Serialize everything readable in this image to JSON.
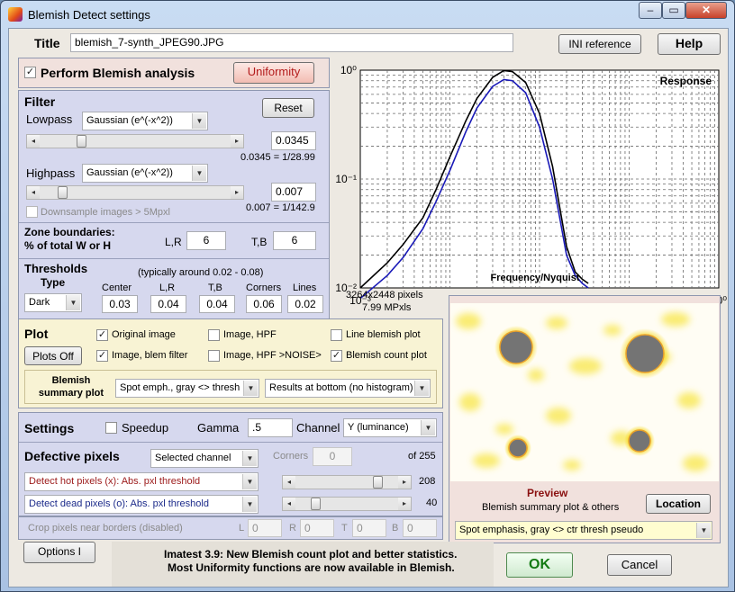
{
  "window": {
    "title": "Blemish Detect settings",
    "controls": {
      "minimize": "–",
      "maximize": "▭",
      "close": "✕"
    }
  },
  "title_row": {
    "label": "Title",
    "value": "blemish_7-synth_JPEG90.JPG",
    "ini_button": "INI reference",
    "help_button": "Help"
  },
  "blemish": {
    "perform_label": "Perform Blemish analysis",
    "perform_checked": true,
    "uniformity_button": "Uniformity"
  },
  "filter": {
    "heading": "Filter",
    "reset_button": "Reset",
    "lowpass": {
      "label": "Lowpass",
      "type": "Gaussian (e^(-x^2))",
      "value": "0.0345",
      "caption": "0.0345 = 1/28.99",
      "slider_fraction": 0.2
    },
    "highpass": {
      "label": "Highpass",
      "type": "Gaussian (e^(-x^2))",
      "value": "0.007",
      "caption": "0.007 = 1/142.9",
      "slider_fraction": 0.1
    },
    "downsample_label": "Downsample images > 5Mpxl",
    "downsample_checked": false
  },
  "zone": {
    "heading": "Zone boundaries:",
    "subheading": "% of total W or H",
    "lr_label": "L,R",
    "lr_value": "6",
    "tb_label": "T,B",
    "tb_value": "6"
  },
  "thresholds": {
    "heading": "Thresholds",
    "note": "(typically around 0.02 - 0.08)",
    "type_label": "Type",
    "type_value": "Dark",
    "columns": [
      {
        "label": "Center",
        "value": "0.03"
      },
      {
        "label": "L,R",
        "value": "0.04"
      },
      {
        "label": "T,B",
        "value": "0.04"
      },
      {
        "label": "Corners",
        "value": "0.06"
      },
      {
        "label": "Lines",
        "value": "0.02"
      }
    ]
  },
  "plot": {
    "heading": "Plot",
    "plots_off_button": "Plots Off",
    "options": [
      {
        "label": "Original image",
        "checked": true
      },
      {
        "label": "Image, HPF",
        "checked": false
      },
      {
        "label": "Line blemish plot",
        "checked": false
      },
      {
        "label": "Image, blem filter",
        "checked": true
      },
      {
        "label": "Image, HPF >NOISE>",
        "checked": false
      },
      {
        "label": "Blemish count plot",
        "checked": true
      }
    ],
    "summary_label": "Blemish summary plot",
    "summary_select": "Spot emph., gray <> thresh",
    "results_select": "Results at bottom (no histogram)"
  },
  "settings": {
    "heading": "Settings",
    "speedup_label": "Speedup",
    "speedup_checked": false,
    "gamma_label": "Gamma",
    "gamma_value": ".5",
    "channel_label": "Channel",
    "channel_value": "Y (luminance)"
  },
  "defective": {
    "heading": "Defective pixels",
    "channel_select": "Selected channel",
    "corners_label": "Corners",
    "corners_value": "0",
    "of_label": "of 255",
    "hot": {
      "label": "Detect hot pixels (x):",
      "mode": "Abs. pxl threshold",
      "value": "208",
      "fraction": 0.82
    },
    "dead": {
      "label": "Detect dead pixels (o):",
      "mode": "Abs. pxl threshold",
      "value": "40",
      "fraction": 0.16
    }
  },
  "crop": {
    "label": "Crop pixels near borders (disabled)",
    "fields": [
      {
        "label": "L",
        "value": "0"
      },
      {
        "label": "R",
        "value": "0"
      },
      {
        "label": "T",
        "value": "0"
      },
      {
        "label": "B",
        "value": "0"
      }
    ]
  },
  "footer": {
    "options_button": "Options I",
    "notice_line1": "Imatest 3.9: New Blemish count plot and better statistics.",
    "notice_line2": "Most Uniformity functions are now available in Blemish.",
    "ok_button": "OK",
    "cancel_button": "Cancel"
  },
  "chart_data": {
    "type": "line",
    "title": "Response",
    "xlabel": "Frequency/Nyquist",
    "ylabel": "",
    "x_scale": "log",
    "y_scale": "log",
    "xlim": [
      0.001,
      10
    ],
    "ylim": [
      0.01,
      1
    ],
    "x_ticks": [
      "10⁻³",
      "10⁻²",
      "10⁻¹",
      "10⁰"
    ],
    "y_ticks": [
      "10⁻²",
      "10⁻¹",
      "10⁰"
    ],
    "grid": true,
    "series": [
      {
        "color": "#000000",
        "x": [
          0.001,
          0.002,
          0.003,
          0.005,
          0.007,
          0.01,
          0.015,
          0.02,
          0.03,
          0.04,
          0.05,
          0.07,
          0.1,
          0.14,
          0.2,
          0.25,
          0.3,
          0.35
        ],
        "y": [
          0.01,
          0.017,
          0.025,
          0.044,
          0.08,
          0.16,
          0.34,
          0.55,
          0.86,
          0.99,
          0.97,
          0.77,
          0.4,
          0.13,
          0.024,
          0.014,
          0.012,
          0.011
        ]
      },
      {
        "color": "#1a1ab8",
        "x": [
          0.001,
          0.002,
          0.003,
          0.005,
          0.007,
          0.01,
          0.015,
          0.02,
          0.03,
          0.04,
          0.05,
          0.07,
          0.1,
          0.14,
          0.2,
          0.25,
          0.3,
          0.35
        ],
        "y": [
          0.008,
          0.013,
          0.019,
          0.035,
          0.062,
          0.12,
          0.27,
          0.45,
          0.71,
          0.82,
          0.8,
          0.62,
          0.3,
          0.1,
          0.02,
          0.013,
          0.011,
          0.01
        ]
      }
    ]
  },
  "image_info": {
    "pixels": "3264x2448 pixels",
    "mpx": "7.99 MPxls"
  },
  "preview": {
    "heading": "Preview",
    "subtext": "Blemish summary plot & others",
    "location_button": "Location",
    "mode_select": "Spot emphasis, gray <> ctr thresh   pseudo"
  }
}
